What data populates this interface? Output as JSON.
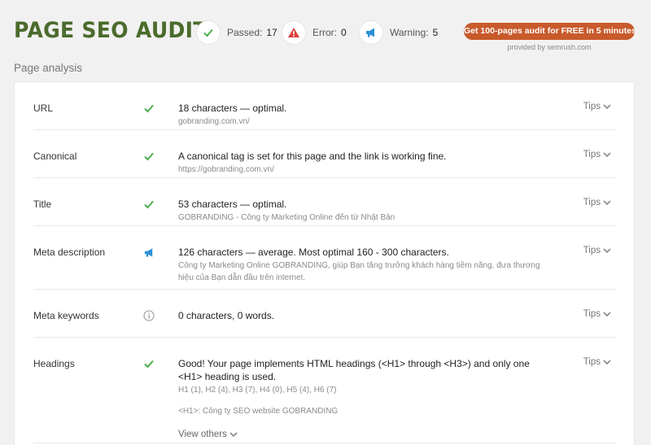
{
  "header": {
    "title": "PAGE SEO AUDIT",
    "passed": {
      "label": "Passed:",
      "count": "17"
    },
    "error": {
      "label": "Error:",
      "count": "0"
    },
    "warning": {
      "label": "Warning:",
      "count": "5"
    },
    "cta_label": "Get 100-pages audit for FREE in 5 minutes",
    "provided_by": "provided by  semrush.com"
  },
  "section_title": "Page analysis",
  "rows": [
    {
      "name": "URL",
      "status": "pass",
      "main": "18 characters — optimal.",
      "sub": "gobranding.com.vn/",
      "tips": "Tips"
    },
    {
      "name": "Canonical",
      "status": "pass",
      "main": "A canonical tag is set for this page and the link is working fine.",
      "sub": "https://gobranding.com.vn/",
      "tips": "Tips"
    },
    {
      "name": "Title",
      "status": "pass",
      "main": "53 characters — optimal.",
      "sub": "GOBRANDING - Công ty Marketing Online đến từ Nhật Bản",
      "tips": "Tips"
    },
    {
      "name": "Meta description",
      "status": "warning",
      "main": "126 characters — average. Most optimal 160 - 300 characters.",
      "sub": "Công ty Marketing Online GOBRANDING, giúp Bạn tăng trưởng khách hàng tiềm năng, đưa thương hiệu của Bạn dẫn đầu trên internet.",
      "tips": "Tips"
    },
    {
      "name": "Meta keywords",
      "status": "info",
      "main": "0 characters, 0 words.",
      "sub": "",
      "tips": "Tips"
    },
    {
      "name": "Headings",
      "status": "pass",
      "main": "Good! Your page implements HTML headings (<H1> through <H3>) and only one <H1> heading is used.",
      "sub": "H1 (1), H2 (4), H3 (7), H4 (0), H5 (4), H6 (7)",
      "h1_text": "<H1>: Công ty SEO website GOBRANDING",
      "view_others": "View others",
      "tips": "Tips"
    }
  ],
  "colors": {
    "title": "#4b6b2c",
    "pass": "#4caf50",
    "error": "#d9403a",
    "warning": "#2a8fd6",
    "cta": "#c85a2b"
  },
  "icons": {
    "pass": "check-icon",
    "error": "error-triangle-icon",
    "warning": "megaphone-icon",
    "info": "info-circle-icon"
  }
}
